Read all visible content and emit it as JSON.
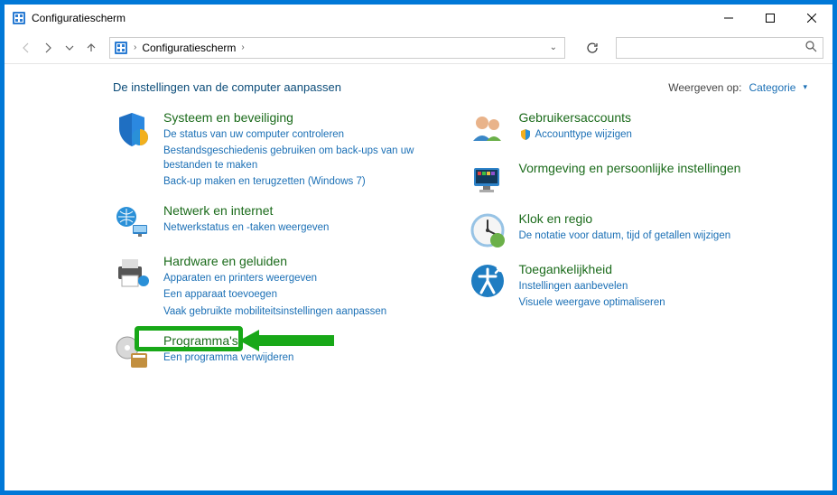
{
  "window": {
    "title": "Configuratiescherm"
  },
  "address": {
    "root": "Configuratiescherm"
  },
  "header": {
    "page_title": "De instellingen van de computer aanpassen",
    "view_by_label": "Weergeven op:",
    "view_by_value": "Categorie"
  },
  "left_col": [
    {
      "icon": "shield",
      "title": "Systeem en beveiliging",
      "links": [
        "De status van uw computer controleren",
        "Bestandsgeschiedenis gebruiken om back-ups van uw bestanden te maken",
        "Back-up maken en terugzetten (Windows 7)"
      ]
    },
    {
      "icon": "network",
      "title": "Netwerk en internet",
      "links": [
        "Netwerkstatus en -taken weergeven"
      ]
    },
    {
      "icon": "hardware",
      "title": "Hardware en geluiden",
      "links": [
        "Apparaten en printers weergeven",
        "Een apparaat toevoegen",
        "Vaak gebruikte mobiliteitsinstellingen aanpassen"
      ]
    },
    {
      "icon": "programs",
      "title": "Programma's",
      "links": [
        "Een programma verwijderen"
      ]
    }
  ],
  "right_col": [
    {
      "icon": "users",
      "title": "Gebruikersaccounts",
      "links_with_icon": [
        {
          "icon": true,
          "text": "Accounttype wijzigen"
        }
      ]
    },
    {
      "icon": "appearance",
      "title": "Vormgeving en persoonlijke instellingen",
      "links": []
    },
    {
      "icon": "clock",
      "title": "Klok en regio",
      "links": [
        "De notatie voor datum, tijd of getallen wijzigen"
      ]
    },
    {
      "icon": "ease",
      "title": "Toegankelijkheid",
      "links": [
        "Instellingen aanbevelen",
        "Visuele weergave optimaliseren"
      ]
    }
  ]
}
